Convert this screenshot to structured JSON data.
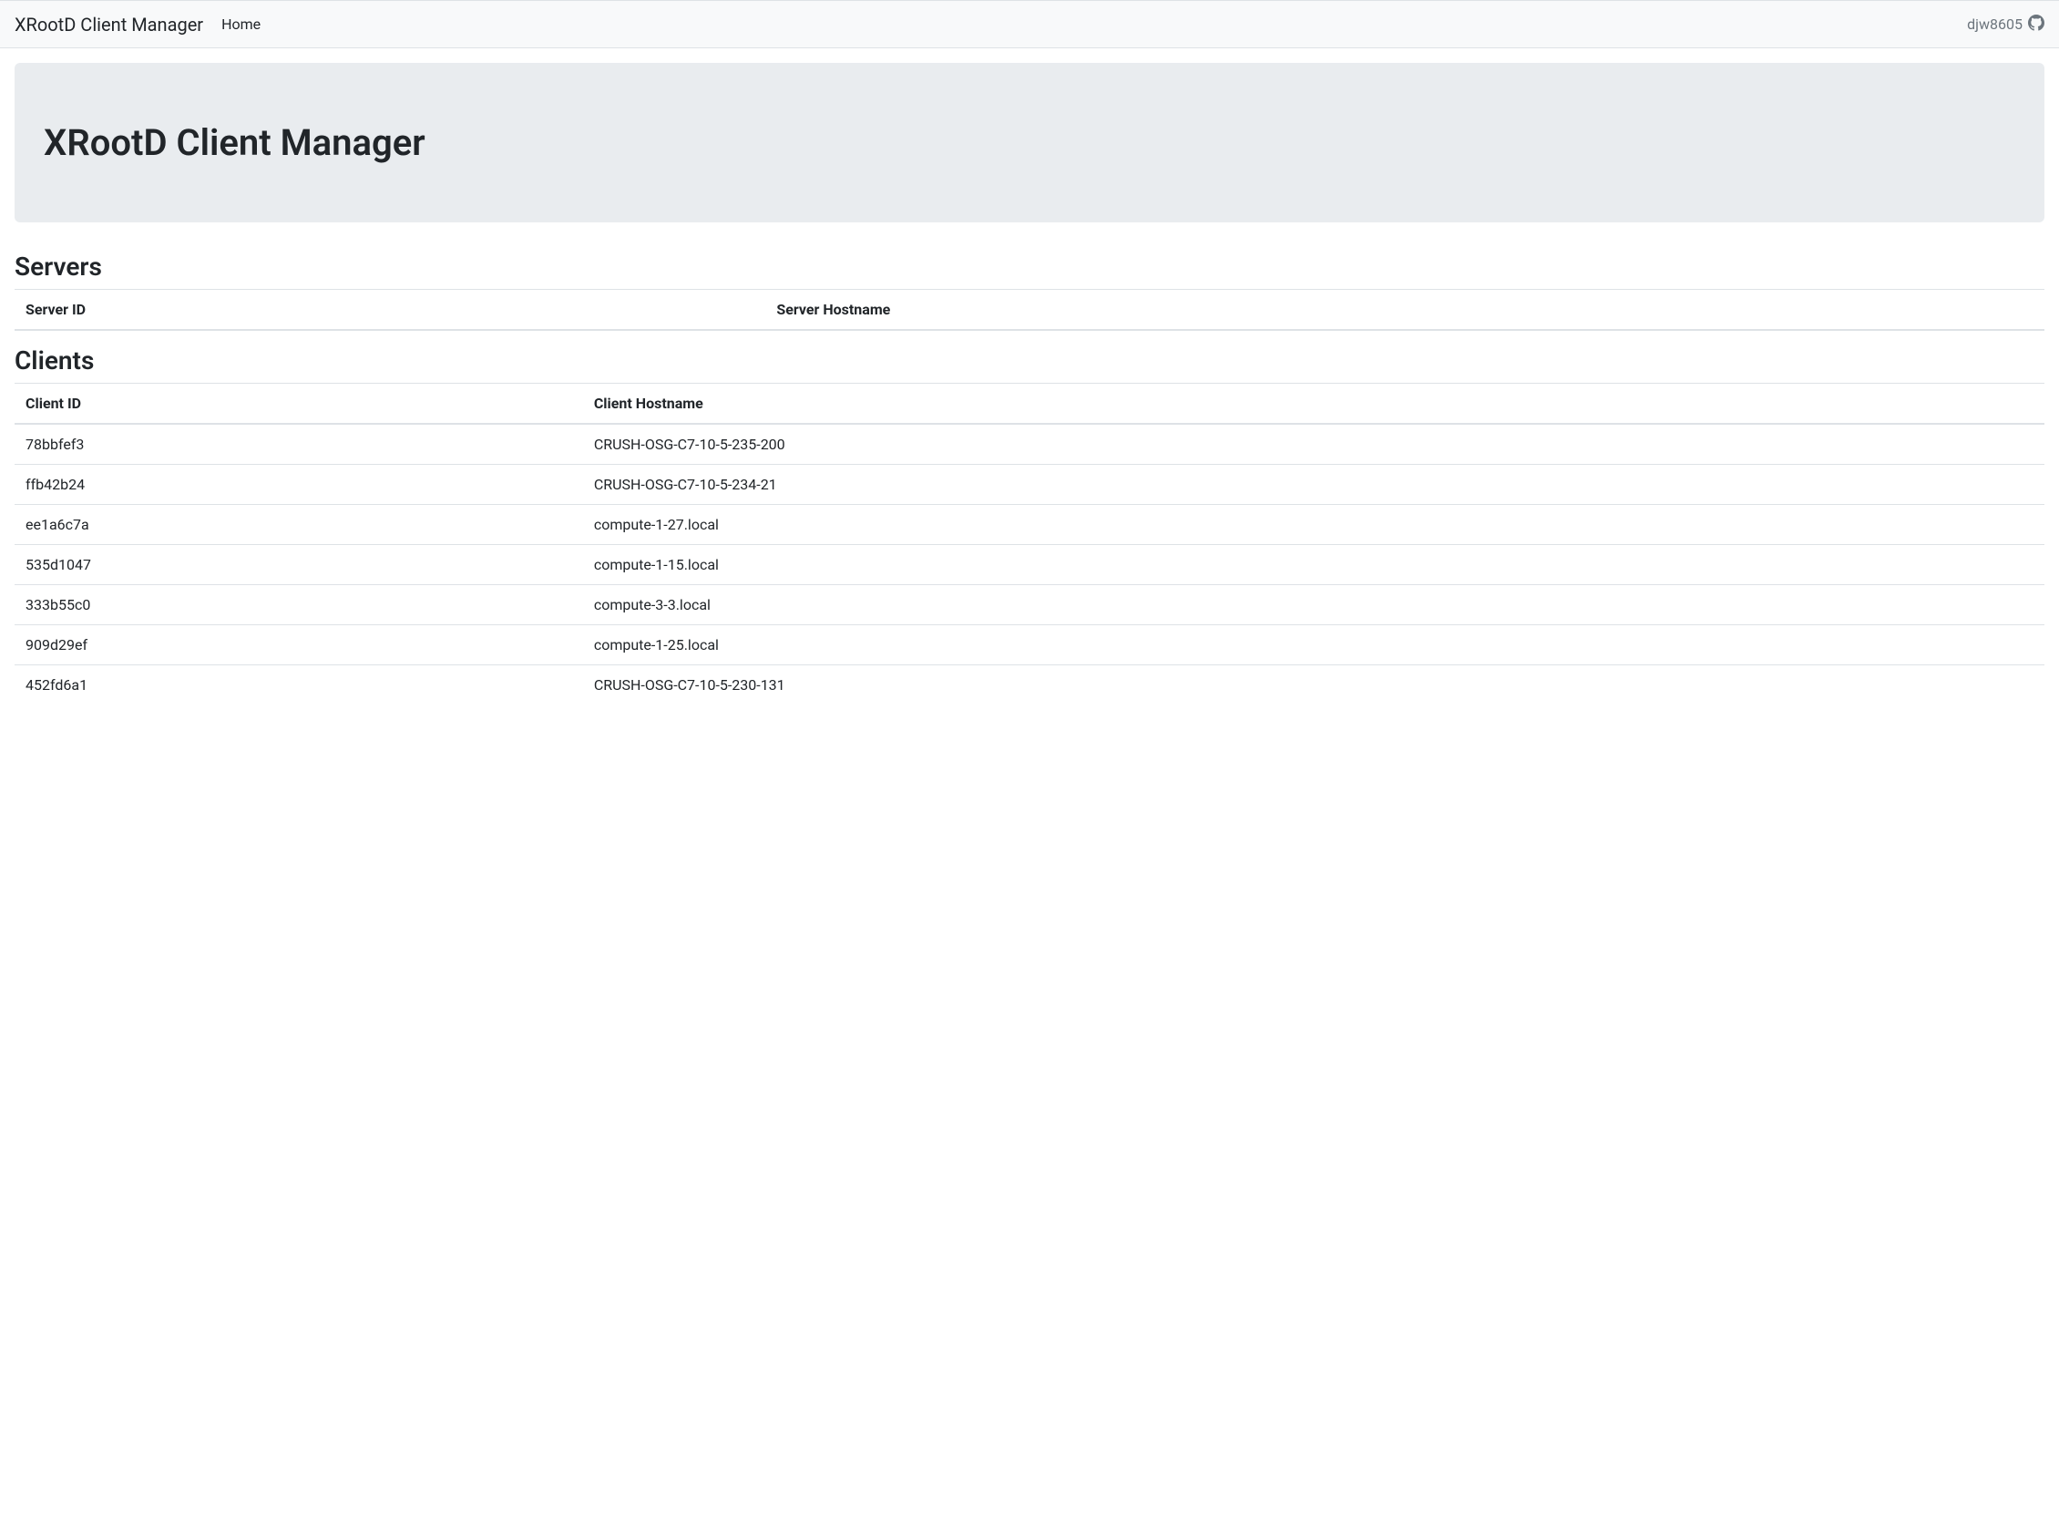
{
  "nav": {
    "brand": "XRootD Client Manager",
    "home": "Home",
    "username": "djw8605"
  },
  "hero": {
    "title": "XRootD Client Manager"
  },
  "servers": {
    "heading": "Servers",
    "columns": [
      "Server ID",
      "Server Hostname"
    ],
    "rows": []
  },
  "clients": {
    "heading": "Clients",
    "columns": [
      "Client ID",
      "Client Hostname"
    ],
    "rows": [
      {
        "id": "78bbfef3",
        "hostname": "CRUSH-OSG-C7-10-5-235-200"
      },
      {
        "id": "ffb42b24",
        "hostname": "CRUSH-OSG-C7-10-5-234-21"
      },
      {
        "id": "ee1a6c7a",
        "hostname": "compute-1-27.local"
      },
      {
        "id": "535d1047",
        "hostname": "compute-1-15.local"
      },
      {
        "id": "333b55c0",
        "hostname": "compute-3-3.local"
      },
      {
        "id": "909d29ef",
        "hostname": "compute-1-25.local"
      },
      {
        "id": "452fd6a1",
        "hostname": "CRUSH-OSG-C7-10-5-230-131"
      }
    ]
  }
}
